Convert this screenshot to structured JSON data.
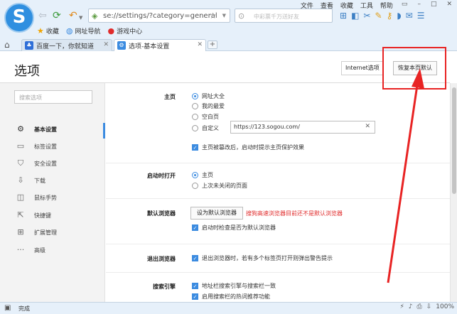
{
  "browser": {
    "logo_letter": "S",
    "address_url": "se://settings/?category=general",
    "search_placeholder": "中彩票千万送好友",
    "menu": [
      "文件",
      "查看",
      "收藏",
      "工具",
      "帮助"
    ],
    "window_controls": [
      "▭",
      "–",
      "□",
      "✕"
    ],
    "favorites": [
      {
        "label": "收藏",
        "icon": "star-icon"
      },
      {
        "label": "网址导航",
        "icon": "globe-icon"
      },
      {
        "label": "游戏中心",
        "icon": "game-icon"
      }
    ],
    "tabs": [
      {
        "title": "百度一下，你就知道",
        "active": false
      },
      {
        "title": "选项-基本设置",
        "active": true
      }
    ]
  },
  "page": {
    "title": "选项",
    "ie_button": "Internet选项",
    "reset_button": "恢复本页默认",
    "side_search_placeholder": "搜索选项",
    "sidebar": [
      {
        "label": "基本设置",
        "icon": "gear-icon",
        "active": true
      },
      {
        "label": "标签设置",
        "icon": "tab-icon",
        "active": false
      },
      {
        "label": "安全设置",
        "icon": "shield-icon",
        "active": false
      },
      {
        "label": "下载",
        "icon": "download-icon",
        "active": false
      },
      {
        "label": "鼠标手势",
        "icon": "mouse-icon",
        "active": false
      },
      {
        "label": "快捷键",
        "icon": "shortcut-icon",
        "active": false
      },
      {
        "label": "扩展管理",
        "icon": "extension-icon",
        "active": false
      },
      {
        "label": "高级",
        "icon": "more-icon",
        "active": false
      }
    ],
    "homepage": {
      "label": "主页",
      "options": [
        "网址大全",
        "我的最爱",
        "空白页",
        "自定义"
      ],
      "selected": "网址大全",
      "custom_url": "https://123.sogou.com/",
      "protect_check": "主页被篡改后，启动时提示主页保护效果"
    },
    "startup": {
      "label": "启动时打开",
      "options": [
        "主页",
        "上次未关闭的页面"
      ],
      "selected": "主页"
    },
    "default_browser": {
      "label": "默认浏览器",
      "button": "设为默认浏览器",
      "warning": "搜狗高速浏览器目前还不是默认浏览器",
      "check": "启动时检查是否为默认浏览器"
    },
    "exit": {
      "label": "退出浏览器",
      "check": "退出浏览器时，若有多个标签页打开则弹出警告提示"
    },
    "search_engine": {
      "label": "搜索引擎",
      "checks": [
        "地址栏搜索引擎与搜索栏一致",
        "启用搜索栏的热词推荐功能"
      ]
    },
    "accent_color": "#3b8be0",
    "annotation_color": "#e82323"
  },
  "status": {
    "text": "完成",
    "zoom": "100%"
  }
}
